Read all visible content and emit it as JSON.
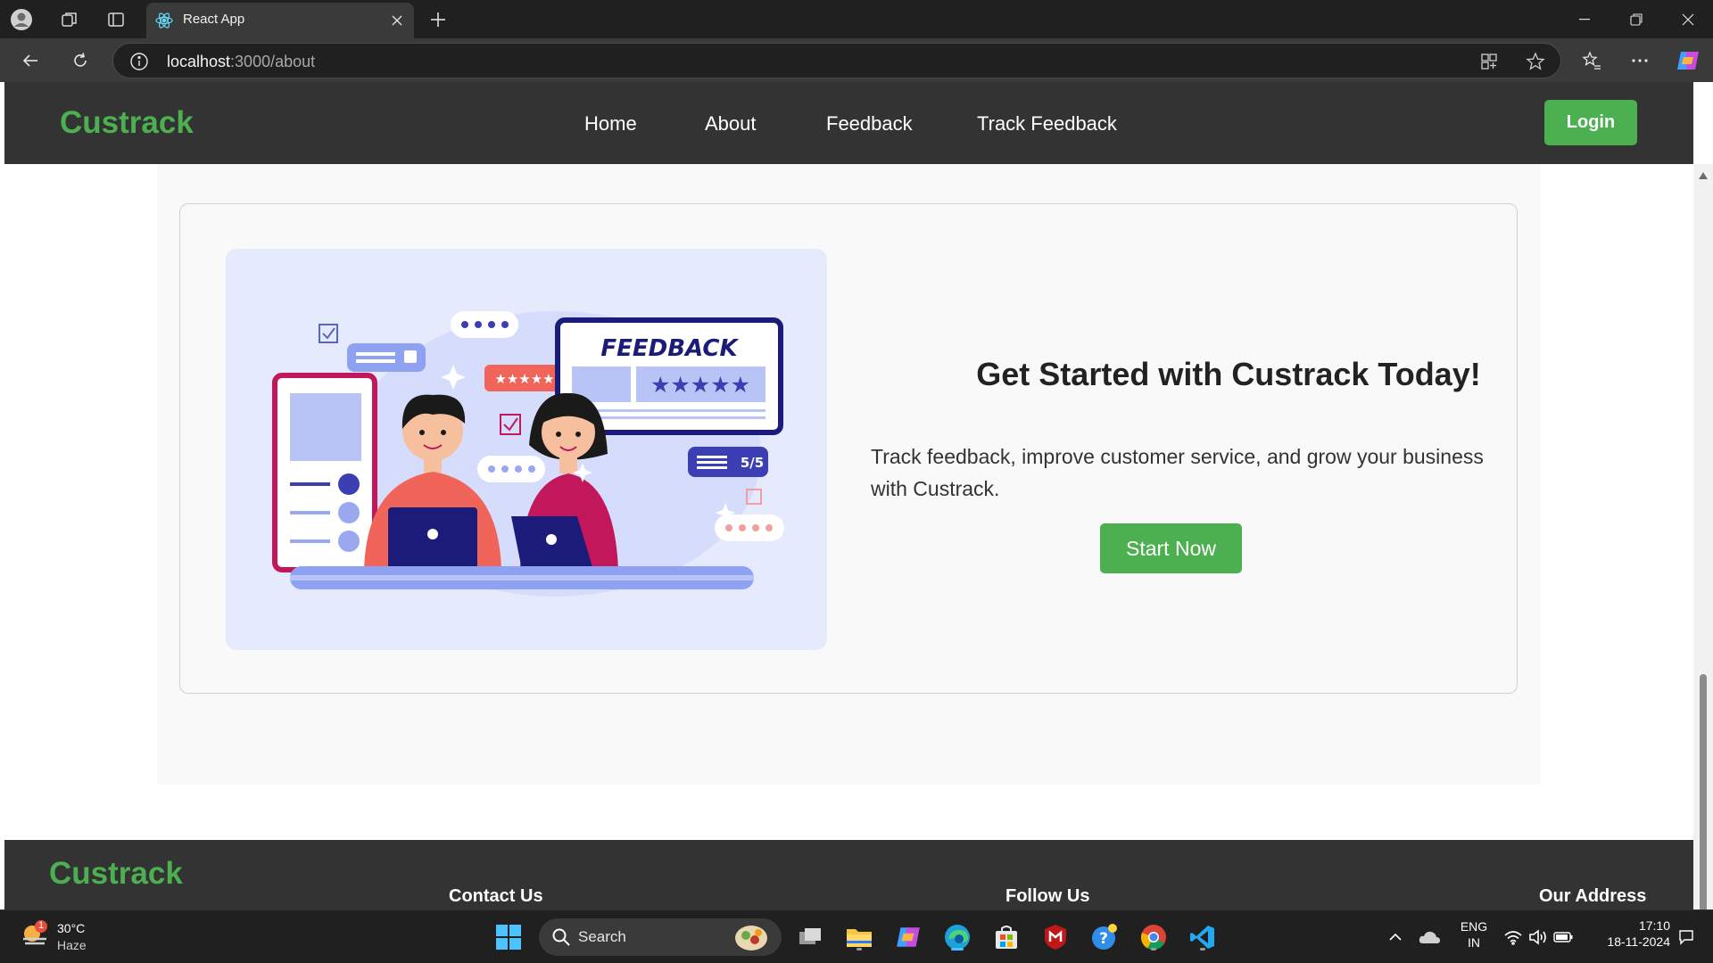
{
  "browser": {
    "tab_title": "React App",
    "url_host": "localhost",
    "url_path": ":3000/about",
    "icons": [
      "profile-icon",
      "workspaces-icon",
      "tab-actions-icon",
      "react-favicon",
      "close-tab-icon",
      "new-tab-icon",
      "minimize-icon",
      "restore-icon",
      "close-window-icon",
      "back-icon",
      "refresh-icon",
      "site-info-icon",
      "app-available-icon",
      "favorite-star-icon",
      "favorites-icon",
      "more-icon",
      "copilot-icon"
    ]
  },
  "site": {
    "brand": "Custrack",
    "nav": [
      "Home",
      "About",
      "Feedback",
      "Track Feedback"
    ],
    "login_label": "Login",
    "hero": {
      "illustration": {
        "sign_text": "FEEDBACK",
        "badge_text": "5/5"
      },
      "title": "Get Started with Custrack Today!",
      "text": "Track feedback, improve customer service, and grow your business with Custrack.",
      "button_label": "Start Now"
    },
    "footer": {
      "brand": "Custrack",
      "headings": [
        "Contact Us",
        "Follow Us",
        "Our Address"
      ]
    }
  },
  "taskbar": {
    "weather": {
      "temp": "30°C",
      "desc": "Haze",
      "badge": "1"
    },
    "search_label": "Search",
    "lang": {
      "line1": "ENG",
      "line2": "IN"
    },
    "clock": {
      "time": "17:10",
      "date": "18-11-2024"
    },
    "apps": [
      "start-icon",
      "task-view-icon",
      "file-explorer-icon",
      "copilot-icon",
      "edge-icon",
      "store-icon",
      "mcafee-icon",
      "help-icon",
      "chrome-icon",
      "vscode-icon"
    ]
  },
  "colors": {
    "brand_green": "#4caf50",
    "nav_bg": "#333333",
    "chrome_dark": "#202020",
    "illustration_bg": "#e6eafd"
  }
}
